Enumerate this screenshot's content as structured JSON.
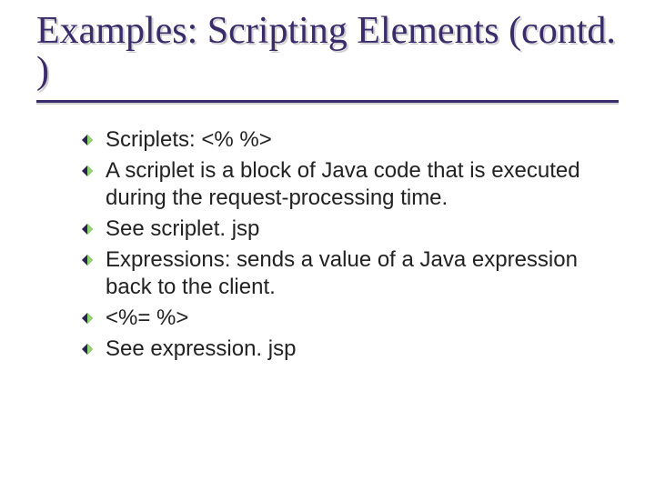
{
  "title": "Examples: Scripting Elements (contd. )",
  "bullets": [
    "Scriplets: <%     %>",
    "A scriplet is a block of Java code that is executed during the request-processing time.",
    "See scriplet. jsp",
    "Expressions: sends a value of a Java expression back to the client.",
    "<%=  %>",
    "See expression. jsp"
  ]
}
